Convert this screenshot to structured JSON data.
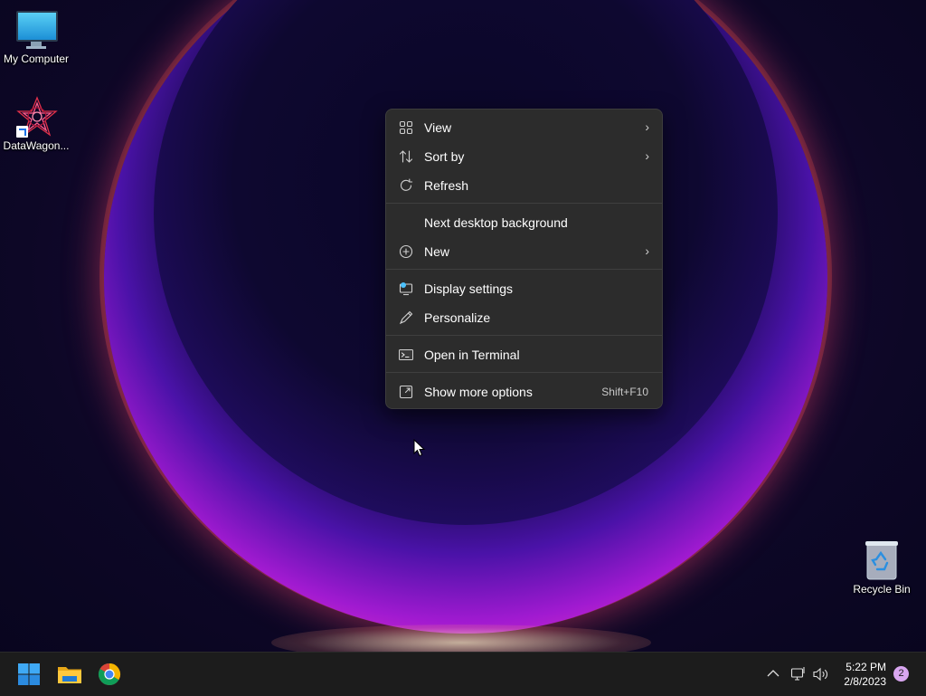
{
  "desktop": {
    "icons": [
      {
        "label": "My Computer",
        "icon": "monitor-icon"
      },
      {
        "label": "DataWagon...",
        "icon": "datawagon-app-icon"
      },
      {
        "label": "Recycle Bin",
        "icon": "recycle-bin-icon"
      }
    ]
  },
  "context_menu": {
    "items": [
      {
        "label": "View",
        "icon": "grid-icon",
        "submenu": true
      },
      {
        "label": "Sort by",
        "icon": "sort-icon",
        "submenu": true
      },
      {
        "label": "Refresh",
        "icon": "refresh-icon"
      },
      {
        "label": "Next desktop background"
      },
      {
        "label": "New",
        "icon": "plus-circle-icon",
        "submenu": true
      },
      {
        "label": "Display settings",
        "icon": "display-settings-icon"
      },
      {
        "label": "Personalize",
        "icon": "pen-icon"
      },
      {
        "label": "Open in Terminal",
        "icon": "terminal-icon"
      },
      {
        "label": "Show more options",
        "icon": "show-more-icon",
        "accelerator": "Shift+F10"
      }
    ],
    "submenu_arrow": "›"
  },
  "taskbar": {
    "apps": [
      {
        "name": "Start",
        "icon": "windows-start-icon"
      },
      {
        "name": "File Explorer",
        "icon": "folder-icon"
      },
      {
        "name": "Google Chrome",
        "icon": "chrome-icon"
      }
    ],
    "tray": {
      "chevron": "^",
      "time": "5:22 PM",
      "date": "2/8/2023",
      "notification_count": "2"
    }
  },
  "colors": {
    "menu_bg": "#2c2c2c",
    "taskbar_bg": "#1c1c1c",
    "accent": "#0078d4"
  }
}
